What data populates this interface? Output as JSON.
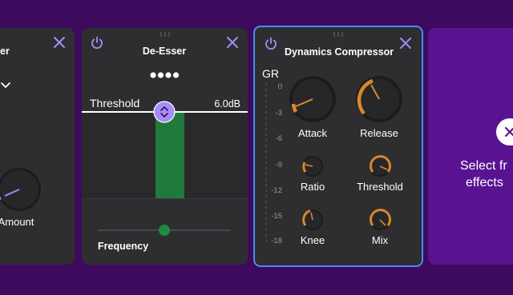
{
  "colors": {
    "background": "#3d0a5e",
    "panel": "#2e2e31",
    "accent": "#a78bfa",
    "selected_border": "#4a8df0",
    "knob_arc": "#d9882a",
    "meter_green": "#1f7a3c",
    "add_panel": "#5a1390"
  },
  "panel_left": {
    "title_fragment": "er",
    "amount_label": "Amount",
    "icons": [
      "close-icon",
      "chevron-down-icon"
    ]
  },
  "deesser": {
    "title": "De-Esser",
    "threshold_label": "Threshold",
    "threshold_value": "6.0dB",
    "frequency_label": "Frequency",
    "frequency_slider_fraction": 0.5,
    "icons": [
      "power-icon",
      "close-icon",
      "more-dots-icon",
      "drag-grip-icon",
      "up-down-arrows-icon"
    ]
  },
  "compressor": {
    "title": "Dynamics Compressor",
    "gr_label": "GR",
    "gr_scale": [
      "0",
      "-3",
      "-6",
      "-9",
      "-12",
      "-15",
      "-18"
    ],
    "knobs": {
      "attack": "Attack",
      "release": "Release",
      "ratio": "Ratio",
      "threshold": "Threshold",
      "knee": "Knee",
      "mix": "Mix"
    },
    "icons": [
      "power-icon",
      "close-icon",
      "drag-grip-icon"
    ]
  },
  "add_effect": {
    "text_line1": "Select fr",
    "text_line2": "effects",
    "icons": [
      "close-icon"
    ]
  }
}
